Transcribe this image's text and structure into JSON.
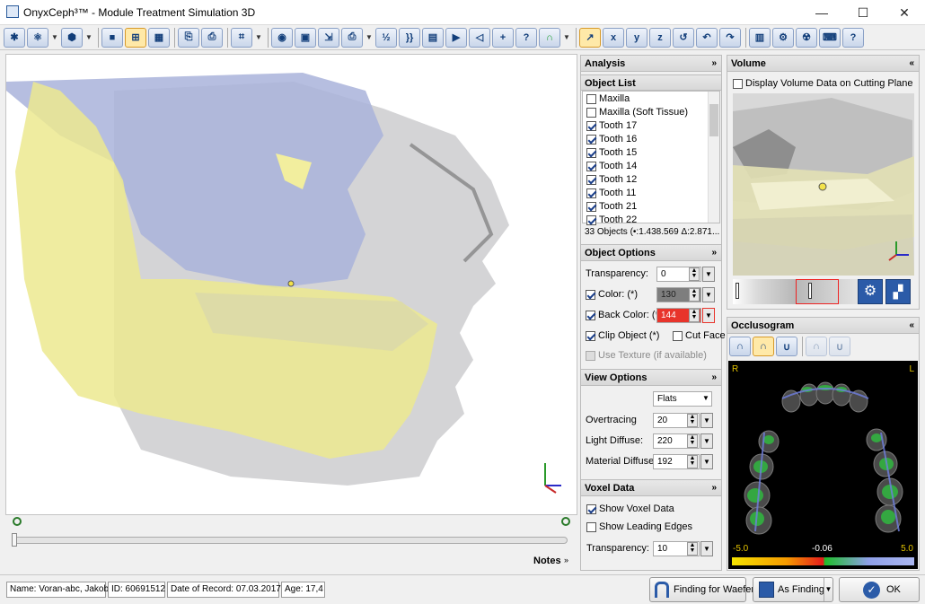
{
  "window": {
    "title": "OnyxCeph³™ - Module Treatment Simulation 3D",
    "minimize": "—",
    "maximize": "☐",
    "close": "✕"
  },
  "toolbar": {
    "icons": [
      "asterisk-icon",
      "tooth-fan-icon",
      "cube-icon",
      "single-view-icon",
      "quad-view-icon",
      "grid-view-icon",
      "open-case-icon",
      "save-case-icon",
      "crop-icon",
      "jaw-icon",
      "save-icon",
      "export-icon",
      "print-icon",
      "ruler-icon",
      "brackets-icon",
      "table-icon",
      "play-icon",
      "eraser-icon",
      "add-icon",
      "help-tooth-icon",
      "arch-icon",
      "move-icon",
      "rotate-x-icon",
      "rotate-y-icon",
      "rotate-z-icon",
      "reset-icon",
      "undo-icon",
      "redo-icon",
      "report-icon",
      "settings-icon",
      "radiation-icon",
      "keyboard-icon",
      "help-icon"
    ]
  },
  "viewport": {
    "notes_label": "Notes"
  },
  "analysis": {
    "title": "Analysis"
  },
  "object_list": {
    "title": "Object List",
    "items": [
      {
        "label": "Maxilla",
        "checked": false
      },
      {
        "label": "Maxilla (Soft Tissue)",
        "checked": false
      },
      {
        "label": "Tooth 17",
        "checked": true
      },
      {
        "label": "Tooth 16",
        "checked": true
      },
      {
        "label": "Tooth 15",
        "checked": true
      },
      {
        "label": "Tooth 14",
        "checked": true
      },
      {
        "label": "Tooth 12",
        "checked": true
      },
      {
        "label": "Tooth 11",
        "checked": true
      },
      {
        "label": "Tooth 21",
        "checked": true
      },
      {
        "label": "Tooth 22",
        "checked": true
      }
    ],
    "summary": "33 Objects (•:1.438.569 Δ:2.871..."
  },
  "object_options": {
    "title": "Object Options",
    "transparency_label": "Transparency:",
    "transparency_value": "0",
    "color_label": "Color: (*)",
    "color_value": "130",
    "back_color_label": "Back Color: (*)",
    "back_color_value": "144",
    "clip_label": "Clip Object (*)",
    "cut_face_label": "Cut Face",
    "texture_label": "Use Texture",
    "texture_note": "(if available)",
    "accent_back": "#e8342b"
  },
  "view_options": {
    "title": "View Options",
    "mode": "Flats",
    "overtracing_label": "Overtracing",
    "overtracing_value": "20",
    "light_label": "Light Diffuse:",
    "light_value": "220",
    "material_label": "Material Diffuse:",
    "material_value": "192"
  },
  "voxel": {
    "title": "Voxel Data",
    "show_label": "Show Voxel Data",
    "edges_label": "Show Leading Edges",
    "transparency_label": "Transparency:",
    "transparency_value": "10"
  },
  "volume": {
    "title": "Volume",
    "cutting_plane_label": "Display Volume Data on Cutting Plane"
  },
  "occlusogram": {
    "title": "Occlusogram",
    "left_marker": "R",
    "right_marker": "L",
    "scale_min": "-5.0",
    "scale_mid": "-0.06",
    "scale_max": "5.0"
  },
  "status": {
    "name": "Name: Voran-abc, Jakob",
    "id": "ID: 60691512",
    "date": "Date of Record: 07.03.2017",
    "age": "Age: 17,4",
    "wafer_button": "Finding for Waefer",
    "as_finding_button": "As Finding",
    "ok_button": "OK"
  }
}
